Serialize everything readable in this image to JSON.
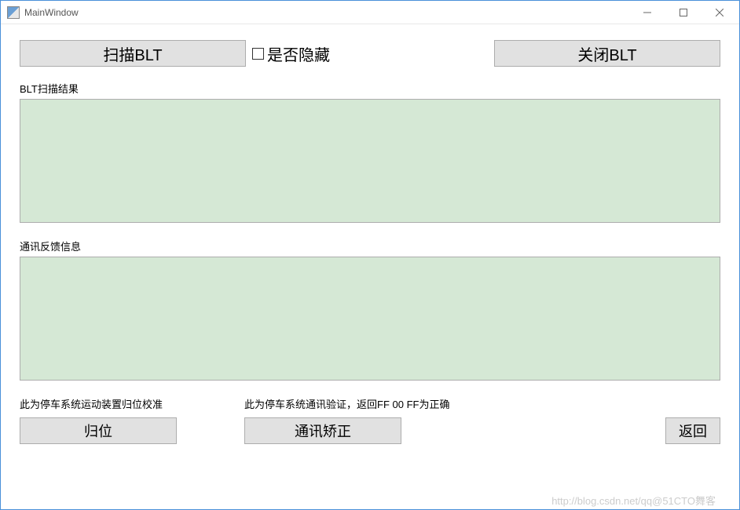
{
  "window": {
    "title": "MainWindow"
  },
  "topRow": {
    "scanButton": "扫描BLT",
    "hideCheckboxLabel": "是否隐藏",
    "closeButton": "关闭BLT"
  },
  "scanResults": {
    "label": "BLT扫描结果"
  },
  "feedback": {
    "label": "通讯反馈信息"
  },
  "bottomLabels": {
    "homeDesc": "此为停车系统运动装置归位校准",
    "commDesc": "此为停车系统通讯验证，返回FF 00 FF为正确"
  },
  "bottomRow": {
    "homeButton": "归位",
    "commButton": "通讯矫正",
    "returnButton": "返回"
  },
  "watermark": "http://blog.csdn.net/qq@51CTO舞客"
}
